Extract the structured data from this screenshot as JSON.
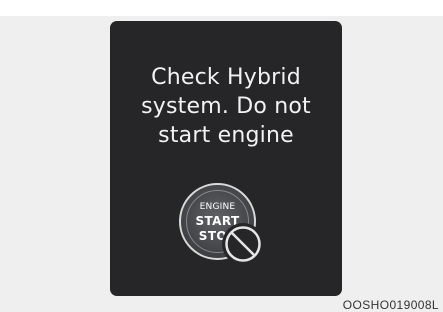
{
  "display": {
    "message": "Check  Hybrid\nsystem. Do not\nstart engine",
    "background_color": "#262628",
    "text_color": "#f2f2f2"
  },
  "start_button": {
    "label_top": "ENGINE",
    "label_middle": "START",
    "label_bottom": "STOP",
    "icon": "engine-start-stop-button"
  },
  "overlay_icon": "no-symbol-icon",
  "footer": {
    "image_code": "OOSHO019008L"
  },
  "colors": {
    "page_background": "#efefef",
    "button_border": "#d9d9d9",
    "prohibition_symbol": "#e6e6e6"
  }
}
